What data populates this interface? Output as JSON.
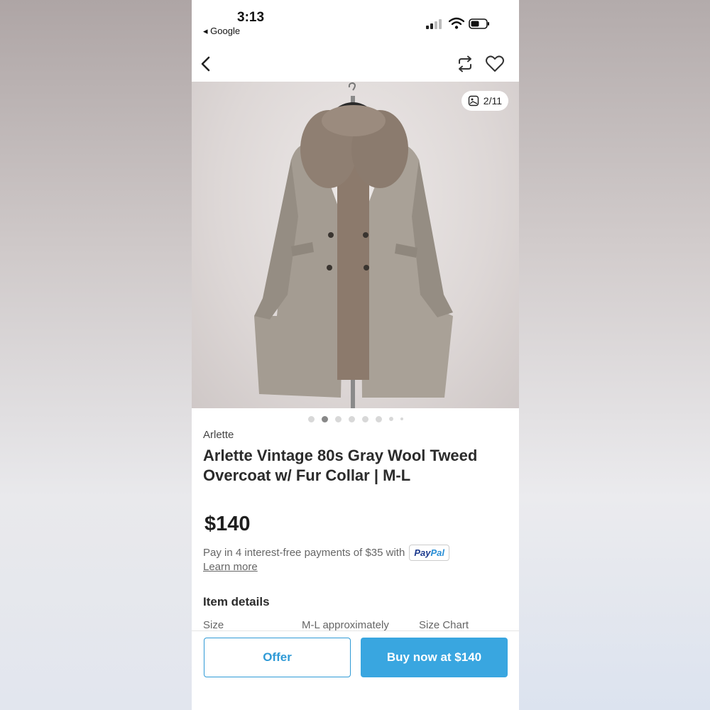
{
  "status_bar": {
    "time": "3:13",
    "back_app": "◂ Google"
  },
  "gallery": {
    "counter": "2/11",
    "dots_total": 8,
    "active_index": 1
  },
  "listing": {
    "brand": "Arlette",
    "title": "Arlette Vintage 80s Gray Wool Tweed Overcoat w/ Fur Collar | M-L",
    "price": "$140",
    "installments_text": "Pay in 4 interest-free payments of $35 with",
    "paypal_part1": "Pay",
    "paypal_part2": "Pal",
    "learn_more": "Learn more"
  },
  "item_details": {
    "heading": "Item details",
    "size_label": "Size",
    "size_value": "M-L approximately",
    "size_chart": "Size Chart"
  },
  "actions": {
    "offer_label": "Offer",
    "buy_label": "Buy now at $140"
  },
  "colors": {
    "accent": "#39a6e0",
    "text": "#2b2b2b"
  }
}
